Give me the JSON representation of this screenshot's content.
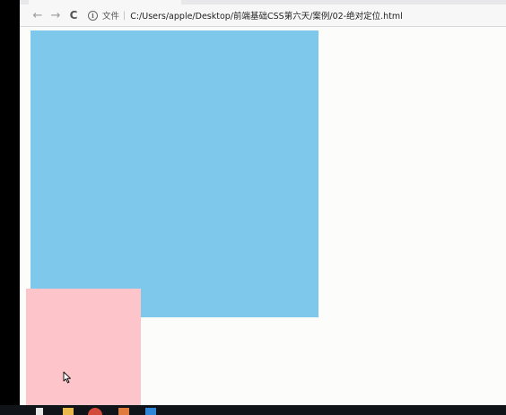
{
  "browser": {
    "nav": {
      "back_icon": "←",
      "forward_icon": "→",
      "reload_icon": "C"
    },
    "omnibox": {
      "info_icon": "i",
      "scheme_label": "文件",
      "separator": "|",
      "url": "C:/Users/apple/Desktop/前端基础CSS第六天/案例/02-绝对定位.html"
    }
  },
  "page": {
    "background": "#fcfdfb",
    "boxes": [
      {
        "name": "blue-box",
        "color": "#7ec8ec"
      },
      {
        "name": "pink-box",
        "color": "#fdc5c9"
      }
    ]
  },
  "taskbar": {
    "icons": [
      "windows-start-icon",
      "file-explorer-icon",
      "chrome-icon",
      "app-icon",
      "vscode-icon"
    ]
  }
}
